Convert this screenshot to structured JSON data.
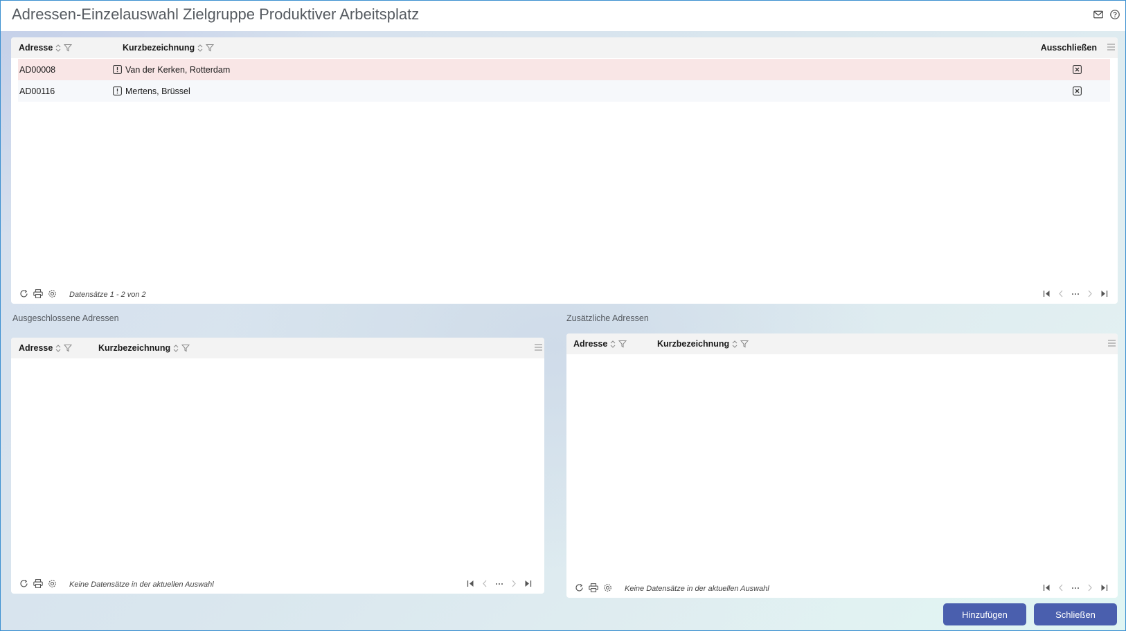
{
  "window": {
    "title": "Adressen-Einzelauswahl Zielgruppe Produktiver Arbeitsplatz"
  },
  "title_icons": [
    "mail-icon",
    "help-icon"
  ],
  "main_grid": {
    "columns": {
      "adresse": "Adresse",
      "kurzbezeichnung": "Kurzbezeichnung",
      "ausschliessen": "Ausschließen"
    },
    "rows": [
      {
        "adresse": "AD00008",
        "kurzbezeichnung": "Van der Kerken, Rotterdam",
        "highlighted": true
      },
      {
        "adresse": "AD00116",
        "kurzbezeichnung": "Mertens, Brüssel",
        "highlighted": false
      }
    ],
    "status": "Datensätze 1 - 2 von 2"
  },
  "excluded": {
    "label": "Ausgeschlossene Adressen",
    "columns": {
      "adresse": "Adresse",
      "kurzbezeichnung": "Kurzbezeichnung"
    },
    "rows": [],
    "status": "Keine Datensätze in der aktuellen Auswahl"
  },
  "additional": {
    "label": "Zusätzliche Adressen",
    "columns": {
      "adresse": "Adresse",
      "kurzbezeichnung": "Kurzbezeichnung"
    },
    "rows": [],
    "status": "Keine Datensätze in der aktuellen Auswahl"
  },
  "buttons": {
    "add": "Hinzufügen",
    "close": "Schließen"
  },
  "colors": {
    "highlight_row": "#f9e6e6",
    "alt_row": "#f6f8fb",
    "button": "#4a5fae"
  }
}
